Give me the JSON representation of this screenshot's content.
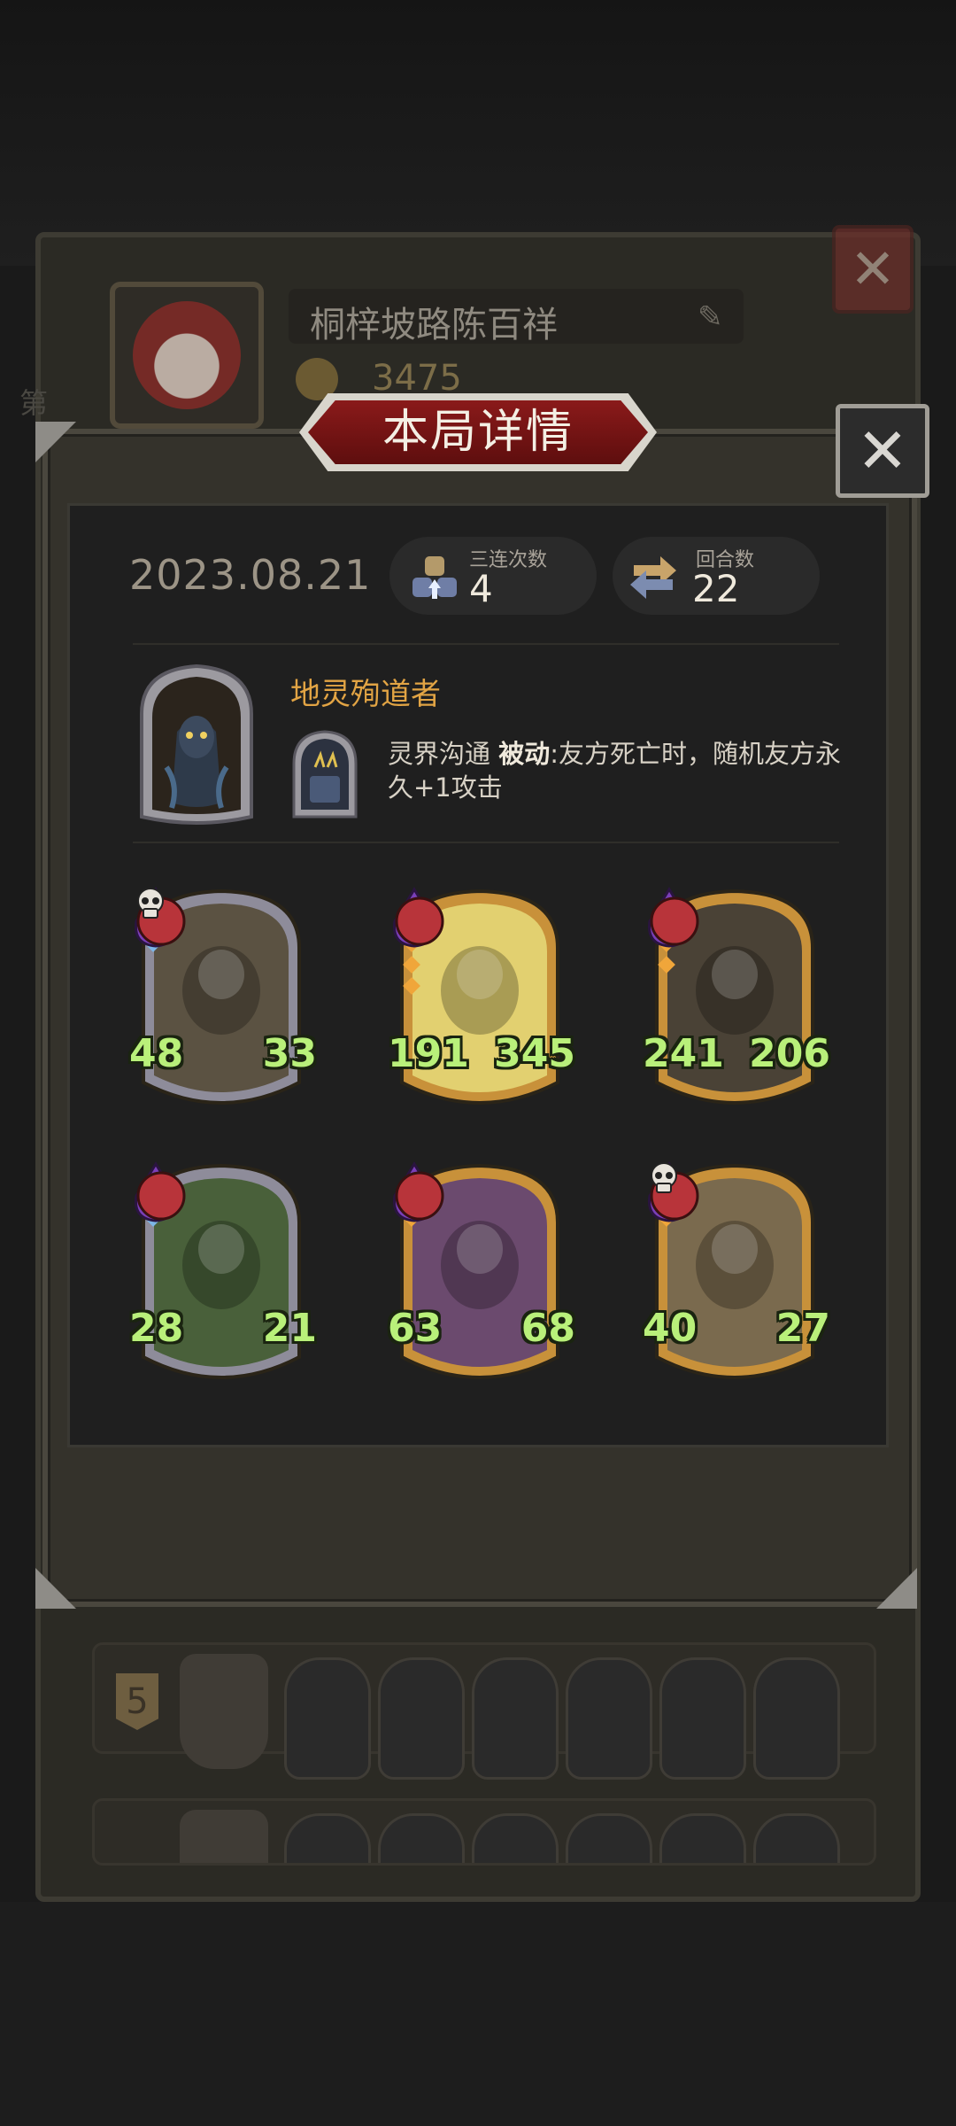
{
  "background": {
    "profile_name": "桐梓坡路陈百祥",
    "score": "3475",
    "row_number": "5",
    "side_text": "第"
  },
  "modal": {
    "title": "本局详情",
    "date": "2023.08.21",
    "stats": {
      "triple": {
        "label": "三连次数",
        "value": "4"
      },
      "rounds": {
        "label": "回合数",
        "value": "22"
      }
    },
    "hero": {
      "name": "地灵殉道者",
      "skill_name": "灵界沟通",
      "skill_type": "被动",
      "skill_desc": ":友方死亡时，随机友方永久+1攻击"
    },
    "cards": [
      {
        "attack": "48",
        "health": "33",
        "frame": "#8e8c9a",
        "art": "#5b5242",
        "deathrattle": true,
        "pips": 2,
        "pip_color": "#7db6e6"
      },
      {
        "attack": "191",
        "health": "345",
        "frame": "#c8913a",
        "art": "#e2d070",
        "deathrattle": false,
        "pips": 4,
        "pip_color": "#f0a63a"
      },
      {
        "attack": "241",
        "health": "206",
        "frame": "#c8913a",
        "art": "#4a4236",
        "deathrattle": false,
        "pips": 3,
        "pip_color": "#f0a63a"
      },
      {
        "attack": "28",
        "health": "21",
        "frame": "#8e8c9a",
        "art": "#49603a",
        "deathrattle": false,
        "pips": 2,
        "pip_color": "#7db6e6"
      },
      {
        "attack": "63",
        "health": "68",
        "frame": "#c8913a",
        "art": "#6b4a6e",
        "deathrattle": false,
        "pips": 2,
        "pip_color": "#f0a63a"
      },
      {
        "attack": "40",
        "health": "27",
        "frame": "#c8913a",
        "art": "#7a6a4e",
        "deathrattle": true,
        "pips": 2,
        "pip_color": "#f0a63a"
      }
    ]
  }
}
